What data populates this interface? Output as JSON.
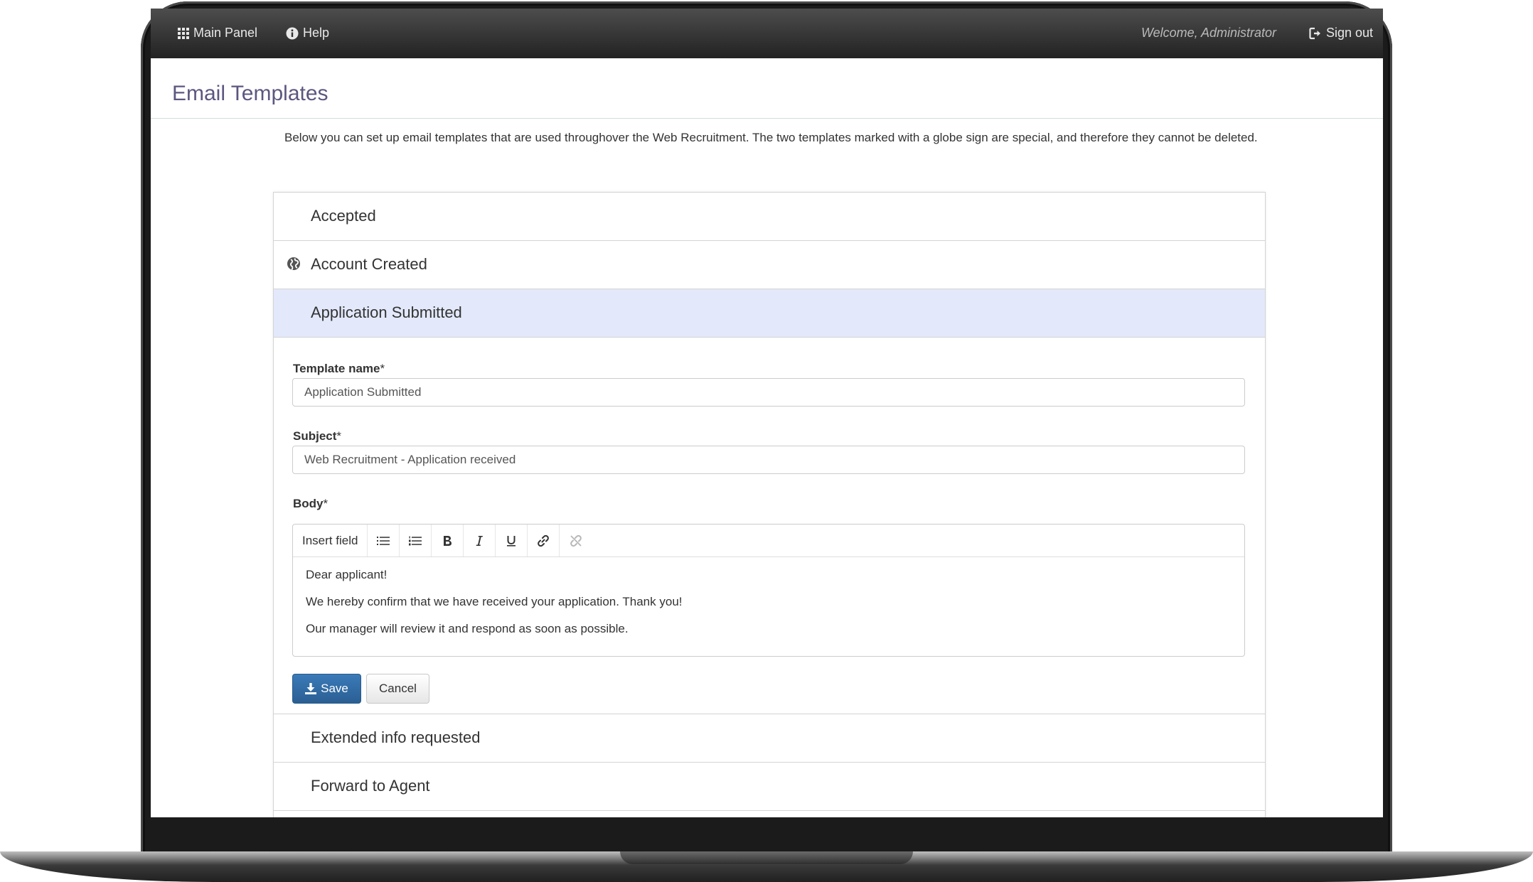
{
  "navbar": {
    "main_panel": "Main Panel",
    "help": "Help",
    "welcome": "Welcome, Administrator",
    "sign_out": "Sign out"
  },
  "page": {
    "title": "Email Templates",
    "intro": "Below you can set up email templates that are used throughover the Web Recruitment. The two templates marked with a globe sign are special, and therefore they cannot be deleted."
  },
  "templates": {
    "items": [
      {
        "label": "Accepted"
      },
      {
        "label": "Account Created",
        "icon": "globe-icon"
      },
      {
        "label": "Application Submitted",
        "active": true
      },
      {
        "label": "Extended info requested"
      },
      {
        "label": "Forward to Agent"
      }
    ]
  },
  "form": {
    "template_name_label": "Template name",
    "template_name_value": "Application Submitted",
    "subject_label": "Subject",
    "subject_value": "Web Recruitment - Application received",
    "body_label": "Body",
    "required_marker": "*",
    "toolbar": {
      "insert_field": "Insert field",
      "icons": [
        "unordered-list-icon",
        "ordered-list-icon",
        "bold-icon",
        "italic-icon",
        "underline-icon",
        "link-icon",
        "unlink-icon"
      ]
    },
    "body_lines": [
      "Dear applicant!",
      "We hereby confirm that we have received your application. Thank you!",
      "Our manager will review it and respond as soon as possible."
    ],
    "save_label": "Save",
    "cancel_label": "Cancel"
  },
  "colors": {
    "navbar": "#2d2d2d",
    "title": "#5b577f",
    "active_row": "#e3e9fb",
    "primary_button": "#2f6aa3"
  }
}
